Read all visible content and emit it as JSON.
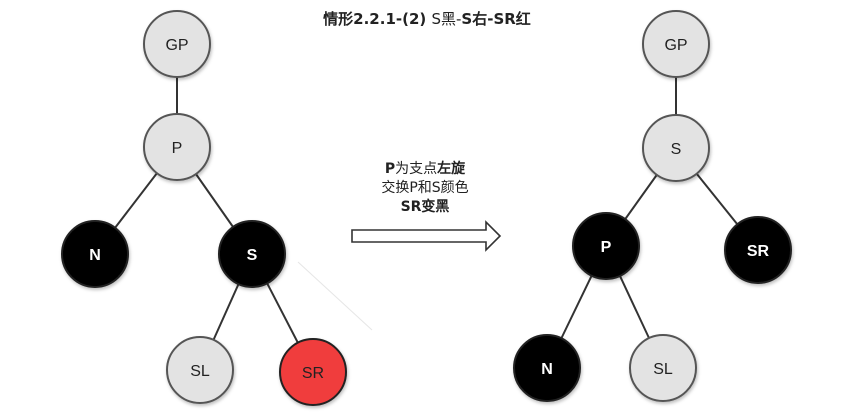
{
  "title": {
    "prefix": "情形2.2.1-(2) ",
    "mid": "S黑-",
    "suffix": "S右-SR红"
  },
  "caption": {
    "line1_bold": "P",
    "line1_normal": "为支点",
    "line1_bold2": "左旋",
    "line2": "交换P和S颜色",
    "line3": "SR变黑"
  },
  "colors": {
    "gray": "#e3e3e3",
    "black": "#000000",
    "red": "#f03c3c",
    "edge": "#333333"
  },
  "before": {
    "nodes": [
      {
        "id": "GP",
        "label": "GP",
        "color": "gray"
      },
      {
        "id": "P",
        "label": "P",
        "color": "gray"
      },
      {
        "id": "N",
        "label": "N",
        "color": "black"
      },
      {
        "id": "S",
        "label": "S",
        "color": "black"
      },
      {
        "id": "SL",
        "label": "SL",
        "color": "gray"
      },
      {
        "id": "SR",
        "label": "SR",
        "color": "red"
      }
    ],
    "edges": [
      [
        "GP",
        "P"
      ],
      [
        "P",
        "N"
      ],
      [
        "P",
        "S"
      ],
      [
        "S",
        "SL"
      ],
      [
        "S",
        "SR"
      ]
    ]
  },
  "after": {
    "nodes": [
      {
        "id": "GP",
        "label": "GP",
        "color": "gray"
      },
      {
        "id": "S",
        "label": "S",
        "color": "gray"
      },
      {
        "id": "P",
        "label": "P",
        "color": "black"
      },
      {
        "id": "SR",
        "label": "SR",
        "color": "black"
      },
      {
        "id": "N",
        "label": "N",
        "color": "black"
      },
      {
        "id": "SL",
        "label": "SL",
        "color": "gray"
      }
    ],
    "edges": [
      [
        "GP",
        "S"
      ],
      [
        "S",
        "P"
      ],
      [
        "S",
        "SR"
      ],
      [
        "P",
        "N"
      ],
      [
        "P",
        "SL"
      ]
    ]
  }
}
